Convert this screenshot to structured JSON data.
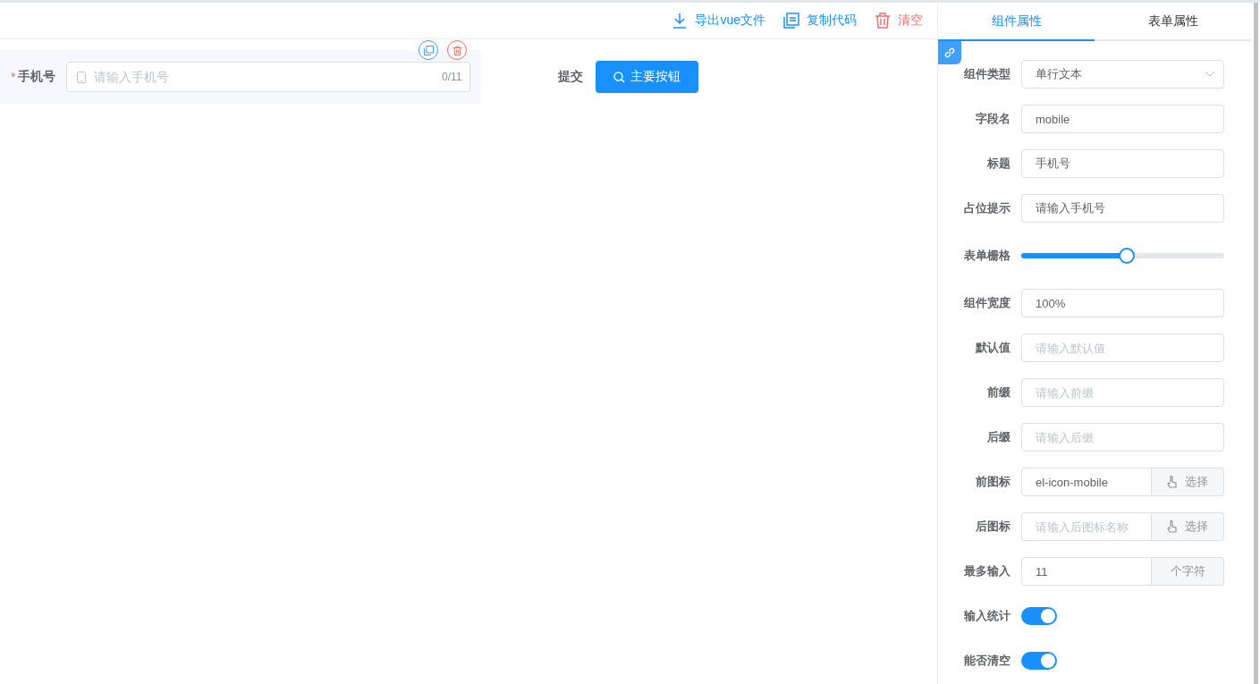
{
  "toolbar": {
    "actions": [
      {
        "label": "导出vue文件",
        "kind": "download"
      },
      {
        "label": "复制代码",
        "kind": "copy"
      },
      {
        "label": "清空",
        "kind": "clear"
      }
    ]
  },
  "canvas": {
    "field": {
      "required_mark": "*",
      "label": "手机号",
      "placeholder": "请输入手机号",
      "counter": "0/11",
      "selected": true
    },
    "submit": {
      "label": "提交",
      "button": "主要按钮"
    }
  },
  "panel": {
    "tabs": [
      {
        "label": "组件属性",
        "selected": true
      },
      {
        "label": "表单属性",
        "selected": false
      }
    ],
    "properties": [
      {
        "kind": "select",
        "label": "组件类型",
        "value": "单行文本"
      },
      {
        "kind": "input",
        "label": "字段名",
        "value": "mobile"
      },
      {
        "kind": "input",
        "label": "标题",
        "value": "手机号"
      },
      {
        "kind": "input",
        "label": "占位提示",
        "value": "请输入手机号"
      },
      {
        "kind": "slider",
        "label": "表单栅格",
        "level": 0.52
      },
      {
        "kind": "input",
        "label": "组件宽度",
        "value": "100%"
      },
      {
        "kind": "input",
        "label": "默认值",
        "placeholder": "请输入默认值"
      },
      {
        "kind": "input",
        "label": "前缀",
        "placeholder": "请输入前缀"
      },
      {
        "kind": "input",
        "label": "后缀",
        "placeholder": "请输入后缀"
      },
      {
        "kind": "picker",
        "label": "前图标",
        "value": "el-icon-mobile",
        "button": "选择"
      },
      {
        "kind": "picker",
        "label": "后图标",
        "placeholder": "请输入后图标名称",
        "button": "选择"
      },
      {
        "kind": "append",
        "label": "最多输入",
        "value": "11",
        "append": "个字符"
      },
      {
        "kind": "switch",
        "label": "输入统计",
        "on": true
      },
      {
        "kind": "switch",
        "label": "能否清空",
        "on": true
      }
    ]
  }
}
